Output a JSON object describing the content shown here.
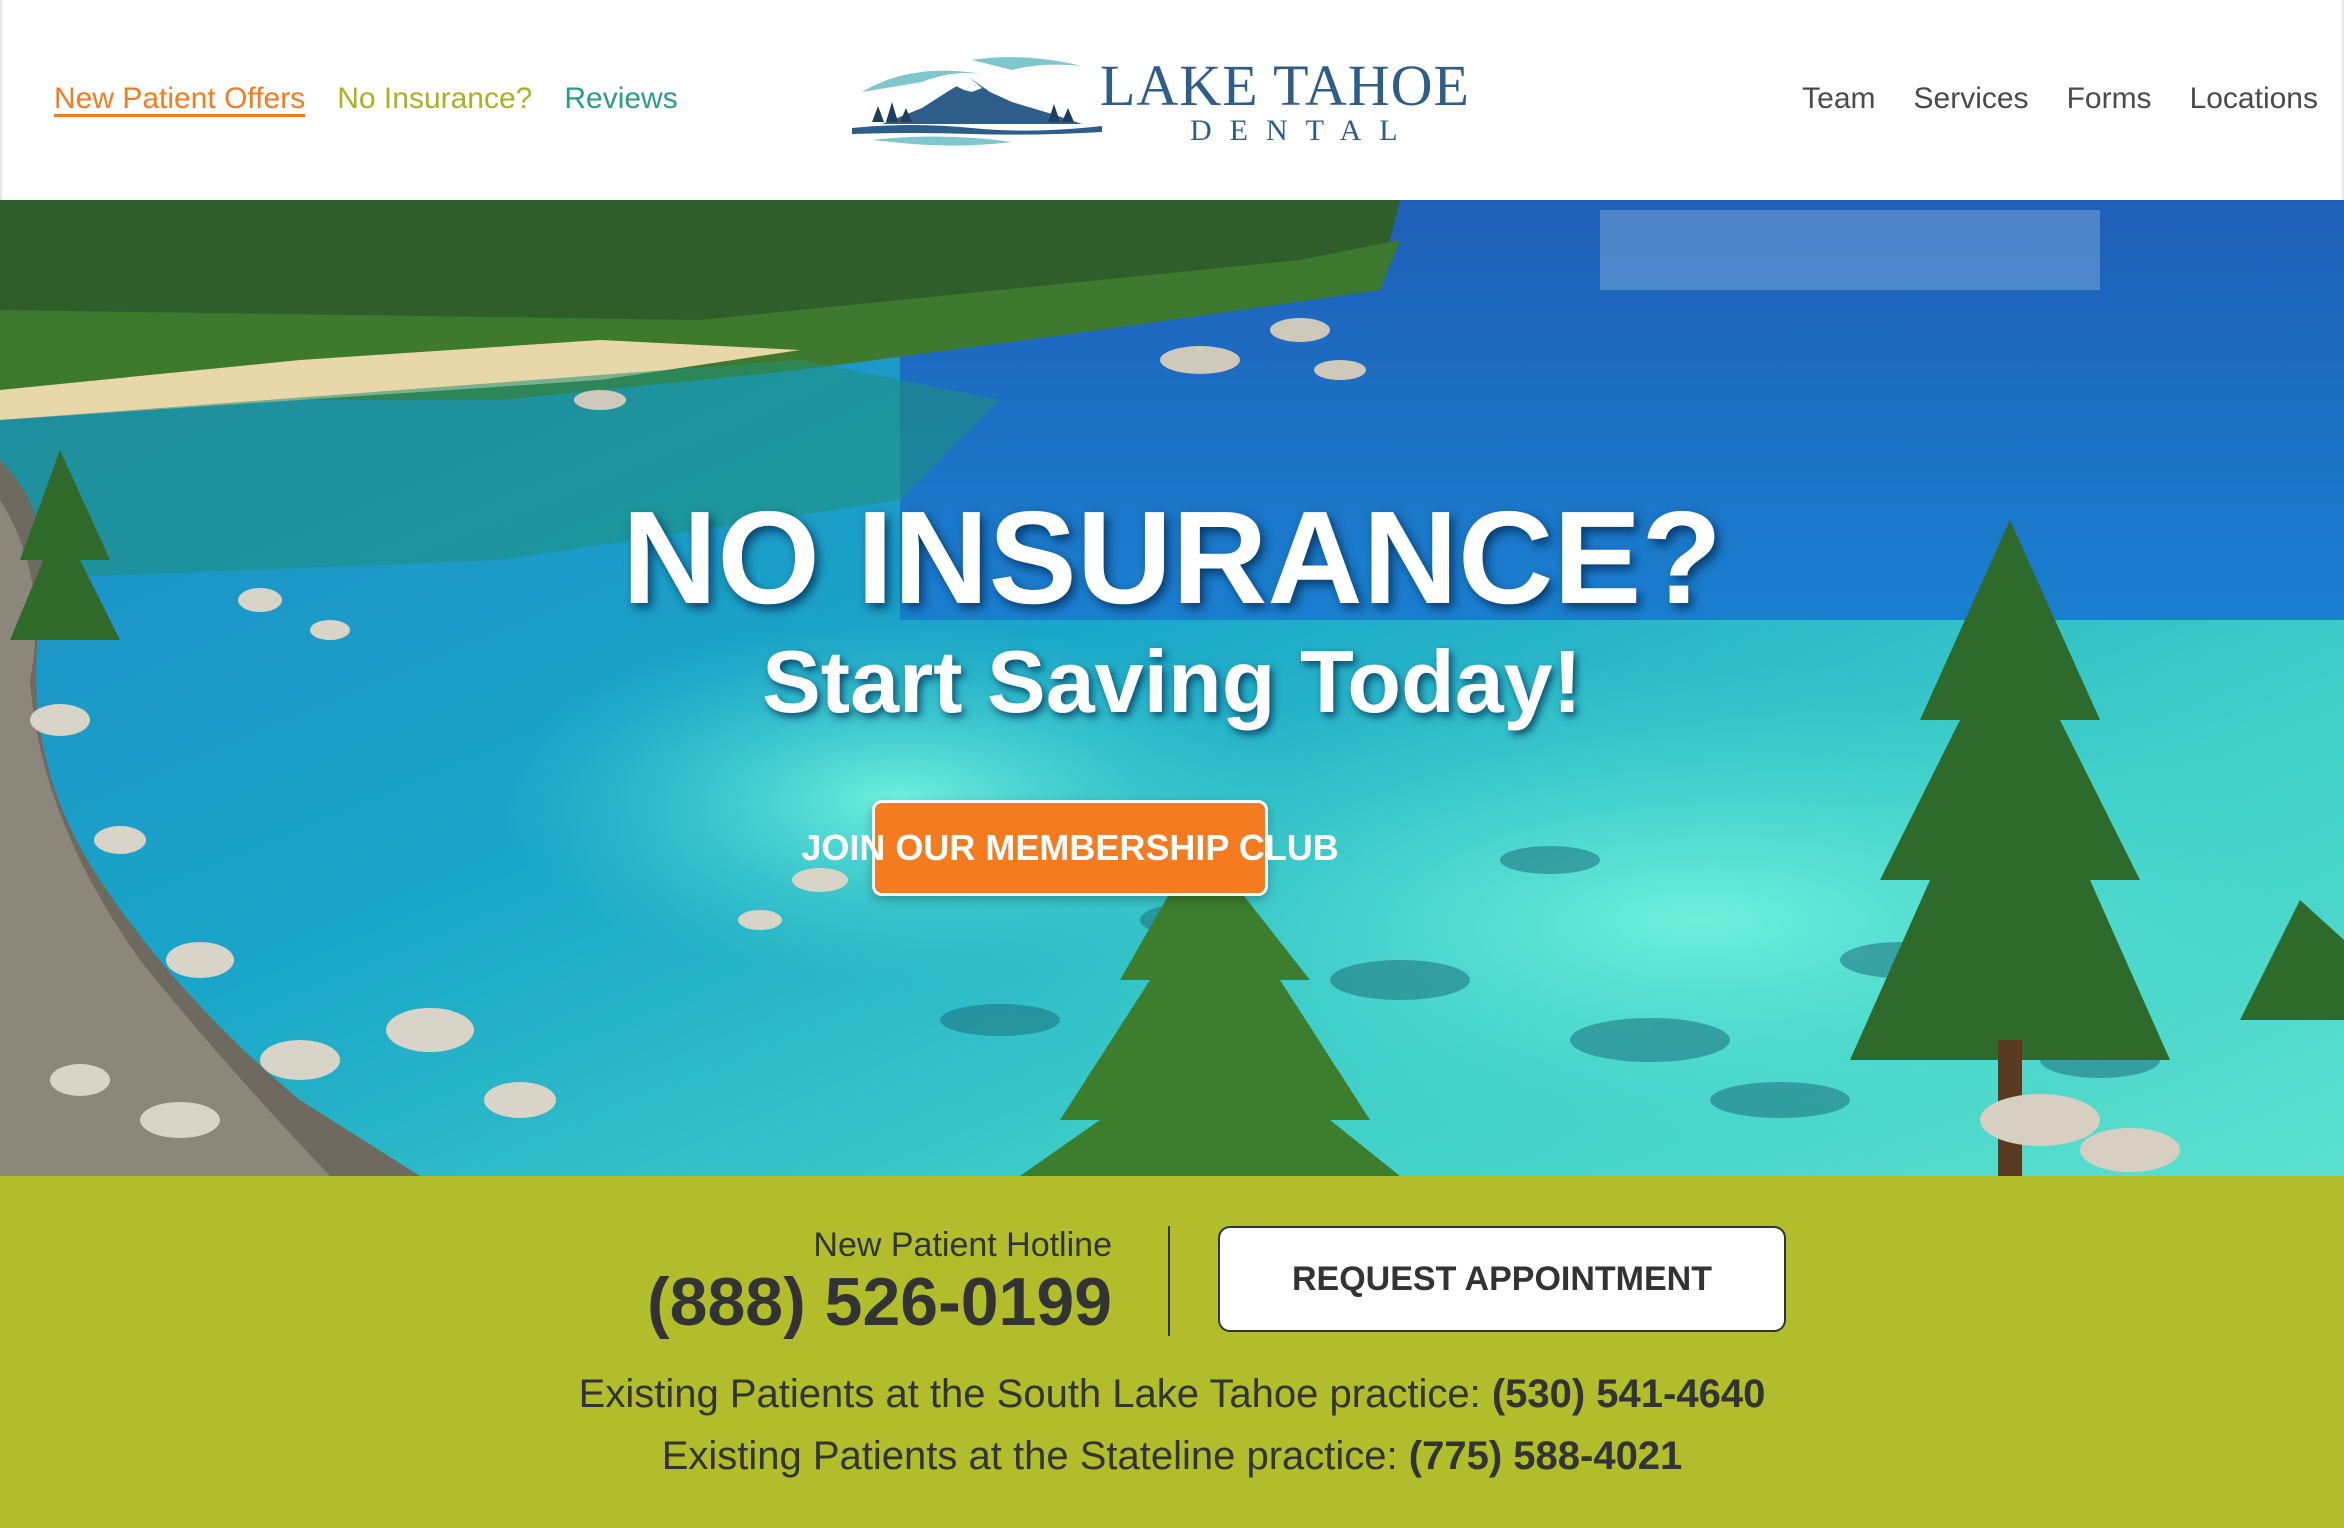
{
  "header": {
    "nav_left": {
      "new_patient_offers": "New Patient Offers",
      "no_insurance": "No Insurance?",
      "reviews": "Reviews"
    },
    "logo": {
      "title": "LAKE TAHOE",
      "subtitle": "DENTAL"
    },
    "nav_right": {
      "team": "Team",
      "services": "Services",
      "forms": "Forms",
      "locations": "Locations"
    }
  },
  "hero": {
    "title": "NO INSURANCE?",
    "subtitle": "Start Saving Today!",
    "cta_label": "JOIN OUR MEMBERSHIP CLUB"
  },
  "contact": {
    "hotline_label": "New Patient Hotline",
    "hotline_number": "(888) 526-0199",
    "request_label": "REQUEST APPOINTMENT",
    "existing": [
      {
        "text": "Existing Patients at the South Lake Tahoe practice: ",
        "phone": "(530) 541-4640"
      },
      {
        "text": "Existing Patients at the Stateline practice: ",
        "phone": "(775) 588-4021"
      }
    ]
  },
  "colors": {
    "accent_orange": "#f47b20",
    "accent_green": "#b1bd2a",
    "teal": "#2a9c8a",
    "logo_blue": "#2f5d8a"
  }
}
